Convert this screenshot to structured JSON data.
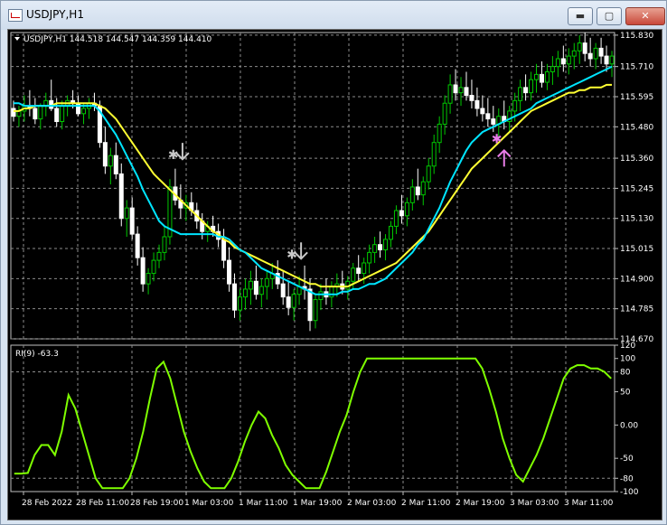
{
  "window": {
    "title": "USDJPY,H1",
    "minimize_label": "▬",
    "maximize_label": "▢",
    "close_label": "✕"
  },
  "colors": {
    "background": "#000000",
    "grid": "#8c8c8c",
    "bull_candle": "#00c800",
    "bear_candle": "#ffffff",
    "ma_fast": "#00e5ff",
    "ma_slow": "#ffff33",
    "indicator": "#7fff00",
    "signal_down": "#c8c8c8",
    "signal_up": "#e87de8"
  },
  "chart_data": [
    {
      "type": "candlestick",
      "title": "USDJPY,H1  144.518 144.547 144.359 144.410",
      "ylim": [
        114.67,
        115.84
      ],
      "yticks": [
        "115.830",
        "115.710",
        "115.595",
        "115.480",
        "115.360",
        "115.245",
        "115.130",
        "115.015",
        "114.900",
        "114.785",
        "114.670"
      ],
      "xticks": [
        "28 Feb 2022",
        "28 Feb 11:00",
        "28 Feb 19:00",
        "1 Mar 03:00",
        "1 Mar 11:00",
        "1 Mar 19:00",
        "2 Mar 03:00",
        "2 Mar 11:00",
        "2 Mar 19:00",
        "3 Mar 03:00",
        "3 Mar 11:00"
      ],
      "bar_count": 112,
      "candles": [
        [
          115.55,
          115.58,
          115.5,
          115.52
        ],
        [
          115.52,
          115.56,
          115.48,
          115.54
        ],
        [
          115.54,
          115.6,
          115.5,
          115.56
        ],
        [
          115.56,
          115.62,
          115.52,
          115.55
        ],
        [
          115.55,
          115.59,
          115.49,
          115.51
        ],
        [
          115.51,
          115.57,
          115.47,
          115.56
        ],
        [
          115.56,
          115.61,
          115.52,
          115.58
        ],
        [
          115.58,
          115.66,
          115.54,
          115.55
        ],
        [
          115.55,
          115.59,
          115.48,
          115.5
        ],
        [
          115.5,
          115.58,
          115.47,
          115.56
        ],
        [
          115.56,
          115.6,
          115.52,
          115.58
        ],
        [
          115.58,
          115.62,
          115.55,
          115.57
        ],
        [
          115.57,
          115.6,
          115.52,
          115.53
        ],
        [
          115.53,
          115.57,
          115.49,
          115.55
        ],
        [
          115.55,
          115.59,
          115.51,
          115.57
        ],
        [
          115.57,
          115.61,
          115.54,
          115.56
        ],
        [
          115.56,
          115.58,
          115.4,
          115.42
        ],
        [
          115.42,
          115.48,
          115.3,
          115.33
        ],
        [
          115.33,
          115.4,
          115.26,
          115.37
        ],
        [
          115.37,
          115.42,
          115.28,
          115.3
        ],
        [
          115.3,
          115.34,
          115.1,
          115.13
        ],
        [
          115.13,
          115.2,
          115.06,
          115.17
        ],
        [
          115.17,
          115.21,
          115.05,
          115.07
        ],
        [
          115.07,
          115.1,
          114.95,
          114.98
        ],
        [
          114.98,
          115.02,
          114.85,
          114.88
        ],
        [
          114.88,
          114.94,
          114.84,
          114.92
        ],
        [
          114.92,
          115.0,
          114.89,
          114.97
        ],
        [
          114.97,
          115.03,
          114.94,
          115.0
        ],
        [
          115.0,
          115.1,
          114.97,
          115.06
        ],
        [
          115.06,
          115.28,
          115.03,
          115.25
        ],
        [
          115.25,
          115.32,
          115.18,
          115.2
        ],
        [
          115.2,
          115.26,
          115.13,
          115.17
        ],
        [
          115.17,
          115.22,
          115.12,
          115.19
        ],
        [
          115.19,
          115.23,
          115.14,
          115.16
        ],
        [
          115.16,
          115.19,
          115.09,
          115.12
        ],
        [
          115.12,
          115.15,
          115.05,
          115.08
        ],
        [
          115.08,
          115.12,
          115.04,
          115.1
        ],
        [
          115.1,
          115.14,
          115.06,
          115.08
        ],
        [
          115.08,
          115.11,
          115.02,
          115.05
        ],
        [
          115.05,
          115.09,
          114.94,
          114.97
        ],
        [
          114.97,
          115.02,
          114.85,
          114.88
        ],
        [
          114.88,
          114.92,
          114.75,
          114.78
        ],
        [
          114.78,
          114.86,
          114.74,
          114.83
        ],
        [
          114.83,
          114.9,
          114.78,
          114.86
        ],
        [
          114.86,
          114.93,
          114.8,
          114.89
        ],
        [
          114.89,
          114.95,
          114.82,
          114.84
        ],
        [
          114.84,
          114.9,
          114.79,
          114.87
        ],
        [
          114.87,
          114.93,
          114.82,
          114.9
        ],
        [
          114.9,
          114.96,
          114.86,
          114.92
        ],
        [
          114.92,
          114.97,
          114.86,
          114.88
        ],
        [
          114.88,
          114.93,
          114.8,
          114.83
        ],
        [
          114.83,
          114.89,
          114.76,
          114.79
        ],
        [
          114.79,
          114.86,
          114.74,
          114.84
        ],
        [
          114.84,
          114.91,
          114.8,
          114.87
        ],
        [
          114.87,
          114.95,
          114.82,
          114.86
        ],
        [
          114.86,
          114.9,
          114.7,
          114.74
        ],
        [
          114.74,
          114.84,
          114.71,
          114.82
        ],
        [
          114.82,
          114.88,
          114.78,
          114.85
        ],
        [
          114.85,
          114.9,
          114.8,
          114.83
        ],
        [
          114.83,
          114.89,
          114.79,
          114.87
        ],
        [
          114.87,
          114.92,
          114.83,
          114.88
        ],
        [
          114.88,
          114.93,
          114.84,
          114.86
        ],
        [
          114.86,
          114.91,
          114.82,
          114.89
        ],
        [
          114.89,
          114.96,
          114.86,
          114.94
        ],
        [
          114.94,
          114.99,
          114.89,
          114.92
        ],
        [
          114.92,
          114.98,
          114.88,
          114.96
        ],
        [
          114.96,
          115.03,
          114.92,
          115.0
        ],
        [
          115.0,
          115.06,
          114.96,
          115.03
        ],
        [
          115.03,
          115.08,
          114.98,
          115.01
        ],
        [
          115.01,
          115.07,
          114.97,
          115.05
        ],
        [
          115.05,
          115.12,
          115.02,
          115.1
        ],
        [
          115.1,
          115.18,
          115.07,
          115.16
        ],
        [
          115.16,
          115.22,
          115.11,
          115.14
        ],
        [
          115.14,
          115.21,
          115.1,
          115.19
        ],
        [
          115.19,
          115.28,
          115.16,
          115.25
        ],
        [
          115.25,
          115.32,
          115.2,
          115.22
        ],
        [
          115.22,
          115.29,
          115.18,
          115.27
        ],
        [
          115.27,
          115.36,
          115.24,
          115.33
        ],
        [
          115.33,
          115.45,
          115.3,
          115.42
        ],
        [
          115.42,
          115.52,
          115.38,
          115.49
        ],
        [
          115.49,
          115.6,
          115.45,
          115.57
        ],
        [
          115.57,
          115.68,
          115.53,
          115.64
        ],
        [
          115.64,
          115.7,
          115.58,
          115.61
        ],
        [
          115.61,
          115.67,
          115.56,
          115.63
        ],
        [
          115.63,
          115.69,
          115.58,
          115.6
        ],
        [
          115.6,
          115.66,
          115.55,
          115.58
        ],
        [
          115.58,
          115.63,
          115.52,
          115.55
        ],
        [
          115.55,
          115.6,
          115.5,
          115.53
        ],
        [
          115.53,
          115.59,
          115.48,
          115.51
        ],
        [
          115.51,
          115.56,
          115.46,
          115.49
        ],
        [
          115.49,
          115.55,
          115.44,
          115.52
        ],
        [
          115.52,
          115.58,
          115.47,
          115.5
        ],
        [
          115.5,
          115.56,
          115.46,
          115.54
        ],
        [
          115.54,
          115.61,
          115.5,
          115.58
        ],
        [
          115.58,
          115.66,
          115.54,
          115.63
        ],
        [
          115.63,
          115.68,
          115.58,
          115.61
        ],
        [
          115.61,
          115.69,
          115.58,
          115.66
        ],
        [
          115.66,
          115.72,
          115.61,
          115.68
        ],
        [
          115.68,
          115.73,
          115.63,
          115.65
        ],
        [
          115.65,
          115.72,
          115.62,
          115.69
        ],
        [
          115.69,
          115.75,
          115.64,
          115.71
        ],
        [
          115.71,
          115.77,
          115.67,
          115.74
        ],
        [
          115.74,
          115.79,
          115.69,
          115.72
        ],
        [
          115.72,
          115.78,
          115.68,
          115.75
        ],
        [
          115.75,
          115.8,
          115.7,
          115.77
        ],
        [
          115.77,
          115.83,
          115.72,
          115.8
        ],
        [
          115.8,
          115.84,
          115.73,
          115.76
        ],
        [
          115.76,
          115.82,
          115.71,
          115.74
        ],
        [
          115.74,
          115.8,
          115.7,
          115.78
        ],
        [
          115.78,
          115.82,
          115.72,
          115.75
        ],
        [
          115.75,
          115.79,
          115.69,
          115.72
        ],
        [
          115.72,
          115.77,
          115.67,
          115.75
        ]
      ],
      "ma_fast": [
        115.57,
        115.57,
        115.56,
        115.56,
        115.56,
        115.56,
        115.56,
        115.56,
        115.56,
        115.56,
        115.56,
        115.56,
        115.56,
        115.56,
        115.56,
        115.56,
        115.54,
        115.51,
        115.48,
        115.45,
        115.41,
        115.37,
        115.33,
        115.29,
        115.24,
        115.2,
        115.16,
        115.12,
        115.1,
        115.09,
        115.08,
        115.07,
        115.07,
        115.07,
        115.07,
        115.07,
        115.07,
        115.07,
        115.06,
        115.06,
        115.05,
        115.03,
        115.01,
        115.0,
        114.98,
        114.96,
        114.94,
        114.93,
        114.92,
        114.91,
        114.9,
        114.89,
        114.88,
        114.87,
        114.86,
        114.85,
        114.84,
        114.84,
        114.84,
        114.84,
        114.84,
        114.85,
        114.85,
        114.86,
        114.86,
        114.87,
        114.88,
        114.88,
        114.89,
        114.9,
        114.92,
        114.94,
        114.96,
        114.98,
        115.0,
        115.03,
        115.05,
        115.09,
        115.13,
        115.17,
        115.22,
        115.27,
        115.31,
        115.35,
        115.39,
        115.42,
        115.44,
        115.46,
        115.47,
        115.48,
        115.49,
        115.5,
        115.51,
        115.52,
        115.53,
        115.54,
        115.55,
        115.57,
        115.58,
        115.59,
        115.6,
        115.61,
        115.62,
        115.63,
        115.64,
        115.65,
        115.66,
        115.67,
        115.68,
        115.69,
        115.7,
        115.71
      ],
      "ma_slow": [
        115.54,
        115.54,
        115.55,
        115.55,
        115.56,
        115.56,
        115.56,
        115.56,
        115.57,
        115.57,
        115.57,
        115.57,
        115.57,
        115.57,
        115.57,
        115.57,
        115.56,
        115.55,
        115.53,
        115.51,
        115.48,
        115.45,
        115.42,
        115.39,
        115.36,
        115.33,
        115.3,
        115.28,
        115.26,
        115.24,
        115.22,
        115.2,
        115.18,
        115.16,
        115.14,
        115.12,
        115.1,
        115.08,
        115.07,
        115.05,
        115.04,
        115.02,
        115.01,
        115.0,
        114.99,
        114.98,
        114.97,
        114.96,
        114.95,
        114.94,
        114.93,
        114.92,
        114.91,
        114.9,
        114.89,
        114.88,
        114.88,
        114.87,
        114.87,
        114.87,
        114.87,
        114.87,
        114.87,
        114.88,
        114.89,
        114.9,
        114.91,
        114.92,
        114.93,
        114.94,
        114.95,
        114.96,
        114.98,
        115.0,
        115.02,
        115.04,
        115.06,
        115.08,
        115.11,
        115.14,
        115.17,
        115.2,
        115.23,
        115.26,
        115.29,
        115.32,
        115.34,
        115.36,
        115.38,
        115.4,
        115.42,
        115.44,
        115.46,
        115.48,
        115.5,
        115.52,
        115.54,
        115.55,
        115.56,
        115.57,
        115.58,
        115.59,
        115.6,
        115.61,
        115.61,
        115.62,
        115.62,
        115.63,
        115.63,
        115.63,
        115.64,
        115.64
      ],
      "signals": [
        {
          "type": "down",
          "bar": 30,
          "price": 115.37
        },
        {
          "type": "down",
          "bar": 52,
          "price": 114.99
        },
        {
          "type": "up",
          "bar": 90,
          "price": 115.39
        }
      ]
    },
    {
      "type": "line",
      "title": "RI(9) -63.3",
      "ylim": [
        -100,
        120
      ],
      "yticks": [
        "120",
        "100",
        "80",
        "50",
        "0.00",
        "-50",
        "-80",
        "-100"
      ],
      "series": [
        {
          "name": "RI(9)",
          "values": [
            -73,
            -73,
            -72,
            -45,
            -30,
            -30,
            -45,
            -10,
            45,
            25,
            -10,
            -45,
            -80,
            -95,
            -95,
            -95,
            -95,
            -80,
            -50,
            -10,
            40,
            85,
            95,
            70,
            30,
            -10,
            -40,
            -65,
            -85,
            -95,
            -95,
            -95,
            -80,
            -55,
            -25,
            0,
            20,
            10,
            -15,
            -35,
            -60,
            -75,
            -85,
            -95,
            -95,
            -95,
            -70,
            -40,
            -10,
            15,
            50,
            80,
            100,
            100,
            100,
            100,
            100,
            100,
            100,
            100,
            100,
            100,
            100,
            100,
            100,
            100,
            100,
            100,
            100,
            85,
            55,
            20,
            -20,
            -50,
            -75,
            -85,
            -65,
            -45,
            -20,
            10,
            40,
            70,
            85,
            90,
            90,
            85,
            85,
            80,
            70
          ]
        }
      ]
    }
  ]
}
